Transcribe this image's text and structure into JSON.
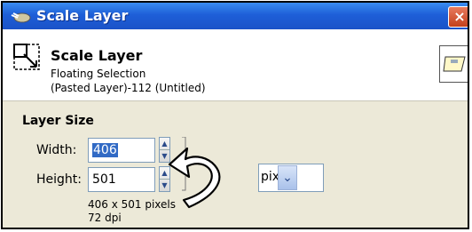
{
  "window": {
    "title": "Scale Layer",
    "close_label": "×"
  },
  "header": {
    "title": "Scale Layer",
    "subtitle": "Floating Selection",
    "layer_name": "(Pasted Layer)-112 (Untitled)"
  },
  "layer_size": {
    "section_label": "Layer Size",
    "width_label": "Width:",
    "width_value": "406",
    "height_label": "Height:",
    "height_value": "501",
    "unit": "pixels",
    "dims_text": "406 x 501 pixels",
    "dpi_text": "72 dpi"
  },
  "icons": [
    "scale-layer-icon",
    "layer-thumbnail-icon",
    "chain-link-icon",
    "spin-up-icon",
    "spin-down-icon",
    "dropdown-arrow-icon"
  ],
  "colors": {
    "titlebar": "#1E5FD8",
    "close_button": "#C4401C",
    "selection_highlight": "#316AC5"
  }
}
